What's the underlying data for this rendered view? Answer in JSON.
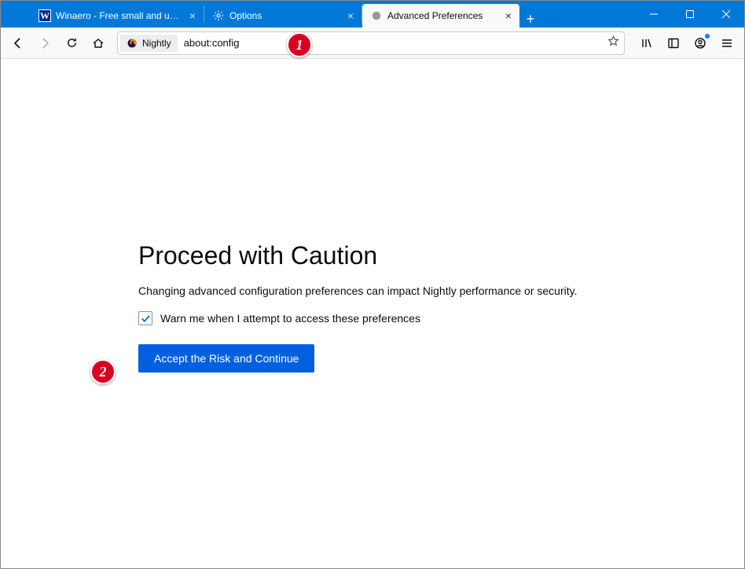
{
  "tabs": [
    {
      "label": "Winaero - Free small and usef…",
      "favicon_letter": "W"
    },
    {
      "label": "Options"
    },
    {
      "label": "Advanced Preferences"
    }
  ],
  "urlbar": {
    "identity_label": "Nightly",
    "url": "about:config"
  },
  "page": {
    "title": "Proceed with Caution",
    "description": "Changing advanced configuration preferences can impact Nightly performance or security.",
    "checkbox_label": "Warn me when I attempt to access these preferences",
    "accept_label": "Accept the Risk and Continue"
  },
  "annotations": {
    "step1": "1",
    "step2": "2"
  }
}
